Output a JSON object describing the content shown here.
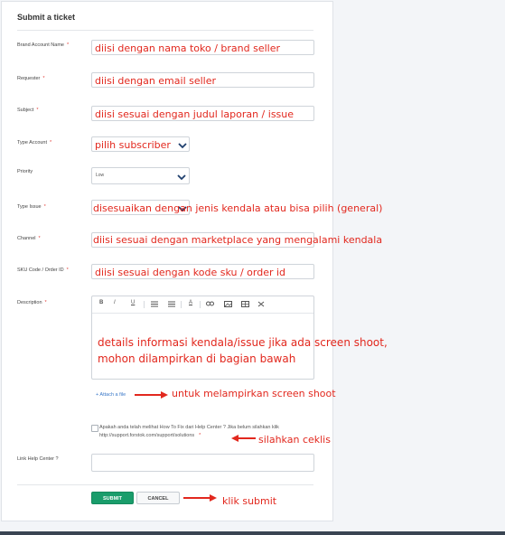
{
  "form": {
    "title": "Submit a ticket",
    "fields": [
      {
        "label": "Brand Account Name",
        "required_mark": "*",
        "annotation": "diisi dengan nama toko / brand seller"
      },
      {
        "label": "Requester",
        "required_mark": "*",
        "annotation": "diisi dengan email seller"
      },
      {
        "label": "Subject",
        "required_mark": "*",
        "annotation": "diisi sesuai dengan judul laporan / issue"
      },
      {
        "label": "Type Account",
        "required_mark": "*",
        "annotation": "pilih subscriber"
      },
      {
        "label": "Priority",
        "value": "Low"
      },
      {
        "label": "Type Issue",
        "required_mark": "*",
        "annotation": "disesuaikan dengan jenis kendala atau bisa pilih (general)"
      },
      {
        "label": "Channel",
        "required_mark": "*",
        "annotation": "diisi sesuai dengan marketplace yang mengalami kendala"
      },
      {
        "label": "SKU Code / Order ID",
        "required_mark": "*",
        "annotation": "diisi sesuai dengan kode sku / order id"
      },
      {
        "label": "Description",
        "required_mark": "*"
      }
    ],
    "editor": {
      "toolbar": [
        "B",
        "I",
        "U",
        "list",
        "list-numbered",
        "A",
        "link",
        "image",
        "table",
        "clear-format"
      ],
      "annotation_line1": "details informasi kendala/issue jika ada screen shoot,",
      "annotation_line2": "mohon dilampirkan di bagian bawah"
    },
    "attach": {
      "label": "+ Attach a file",
      "annotation": "untuk melampirkan screen shoot"
    },
    "checkbox": {
      "line1": "Apakah anda telah melihat How To Fix dari Help Center ? Jika belum silahkan klik",
      "line2": "http://support.forstok.com/support/solutions",
      "required_mark": "*",
      "annotation": "silahkan ceklis"
    },
    "link_help_center": {
      "label": "Link Help Center ?",
      "value": ""
    },
    "buttons": {
      "submit": "SUBMIT",
      "cancel": "CANCEL",
      "annotation": "klik submit"
    }
  },
  "colors": {
    "accent": "#1a9d6b",
    "annotation_red": "#e2281e",
    "chevron": "#1f3f6e",
    "required": "#e2403b"
  }
}
